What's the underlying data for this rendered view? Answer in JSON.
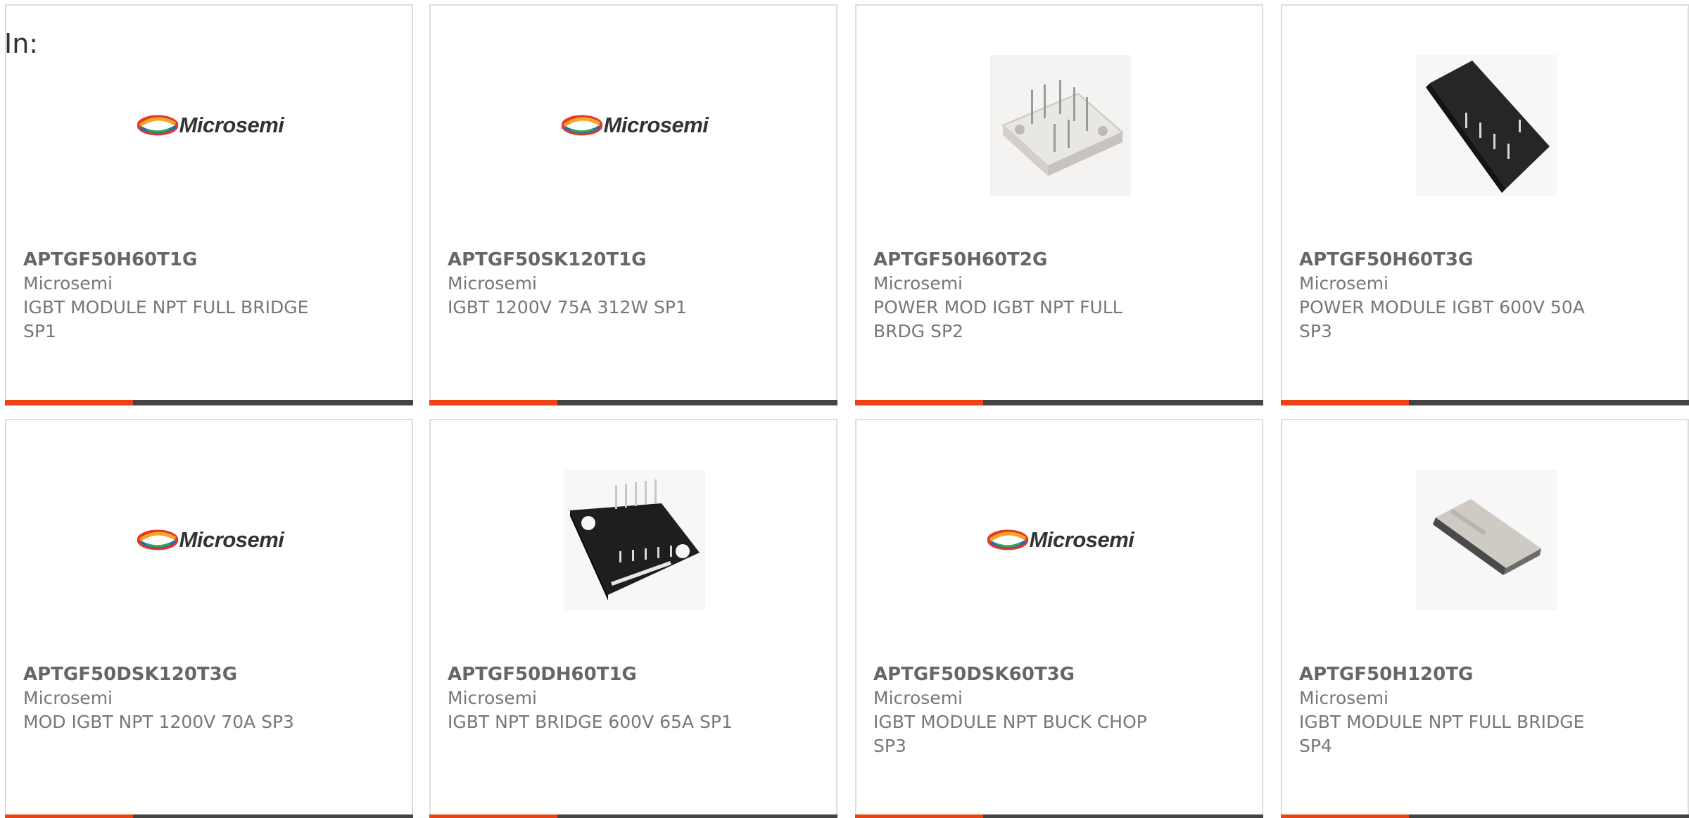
{
  "filter": {
    "label": "In:"
  },
  "products": [
    {
      "part_number": "APTGF50H60T1G",
      "manufacturer": "Microsemi",
      "description": "IGBT MODULE NPT FULL BRIDGE SP1",
      "image": "microsemi-logo"
    },
    {
      "part_number": "APTGF50SK120T1G",
      "manufacturer": "Microsemi",
      "description": "IGBT 1200V 75A 312W SP1",
      "image": "microsemi-logo"
    },
    {
      "part_number": "APTGF50H60T2G",
      "manufacturer": "Microsemi",
      "description": "POWER MOD IGBT NPT FULL BRDG SP2",
      "image": "white-power-module-photo"
    },
    {
      "part_number": "APTGF50H60T3G",
      "manufacturer": "Microsemi",
      "description": "POWER MODULE IGBT 600V 50A SP3",
      "image": "black-power-module-photo"
    },
    {
      "part_number": "APTGF50DSK120T3G",
      "manufacturer": "Microsemi",
      "description": "MOD IGBT NPT 1200V 70A SP3",
      "image": "microsemi-logo"
    },
    {
      "part_number": "APTGF50DH60T1G",
      "manufacturer": "Microsemi",
      "description": "IGBT NPT BRIDGE 600V 65A SP1",
      "image": "black-module-pins-photo"
    },
    {
      "part_number": "APTGF50DSK60T3G",
      "manufacturer": "Microsemi",
      "description": "IGBT MODULE NPT BUCK CHOP SP3",
      "image": "microsemi-logo"
    },
    {
      "part_number": "APTGF50H120TG",
      "manufacturer": "Microsemi",
      "description": "IGBT MODULE NPT FULL BRIDGE SP4",
      "image": "flat-module-photo"
    }
  ],
  "colors": {
    "accent_bar": "#ee4114",
    "dark_bar": "#444444",
    "card_border": "#dddddd",
    "part_number_text": "#666666",
    "body_text": "#777777"
  }
}
